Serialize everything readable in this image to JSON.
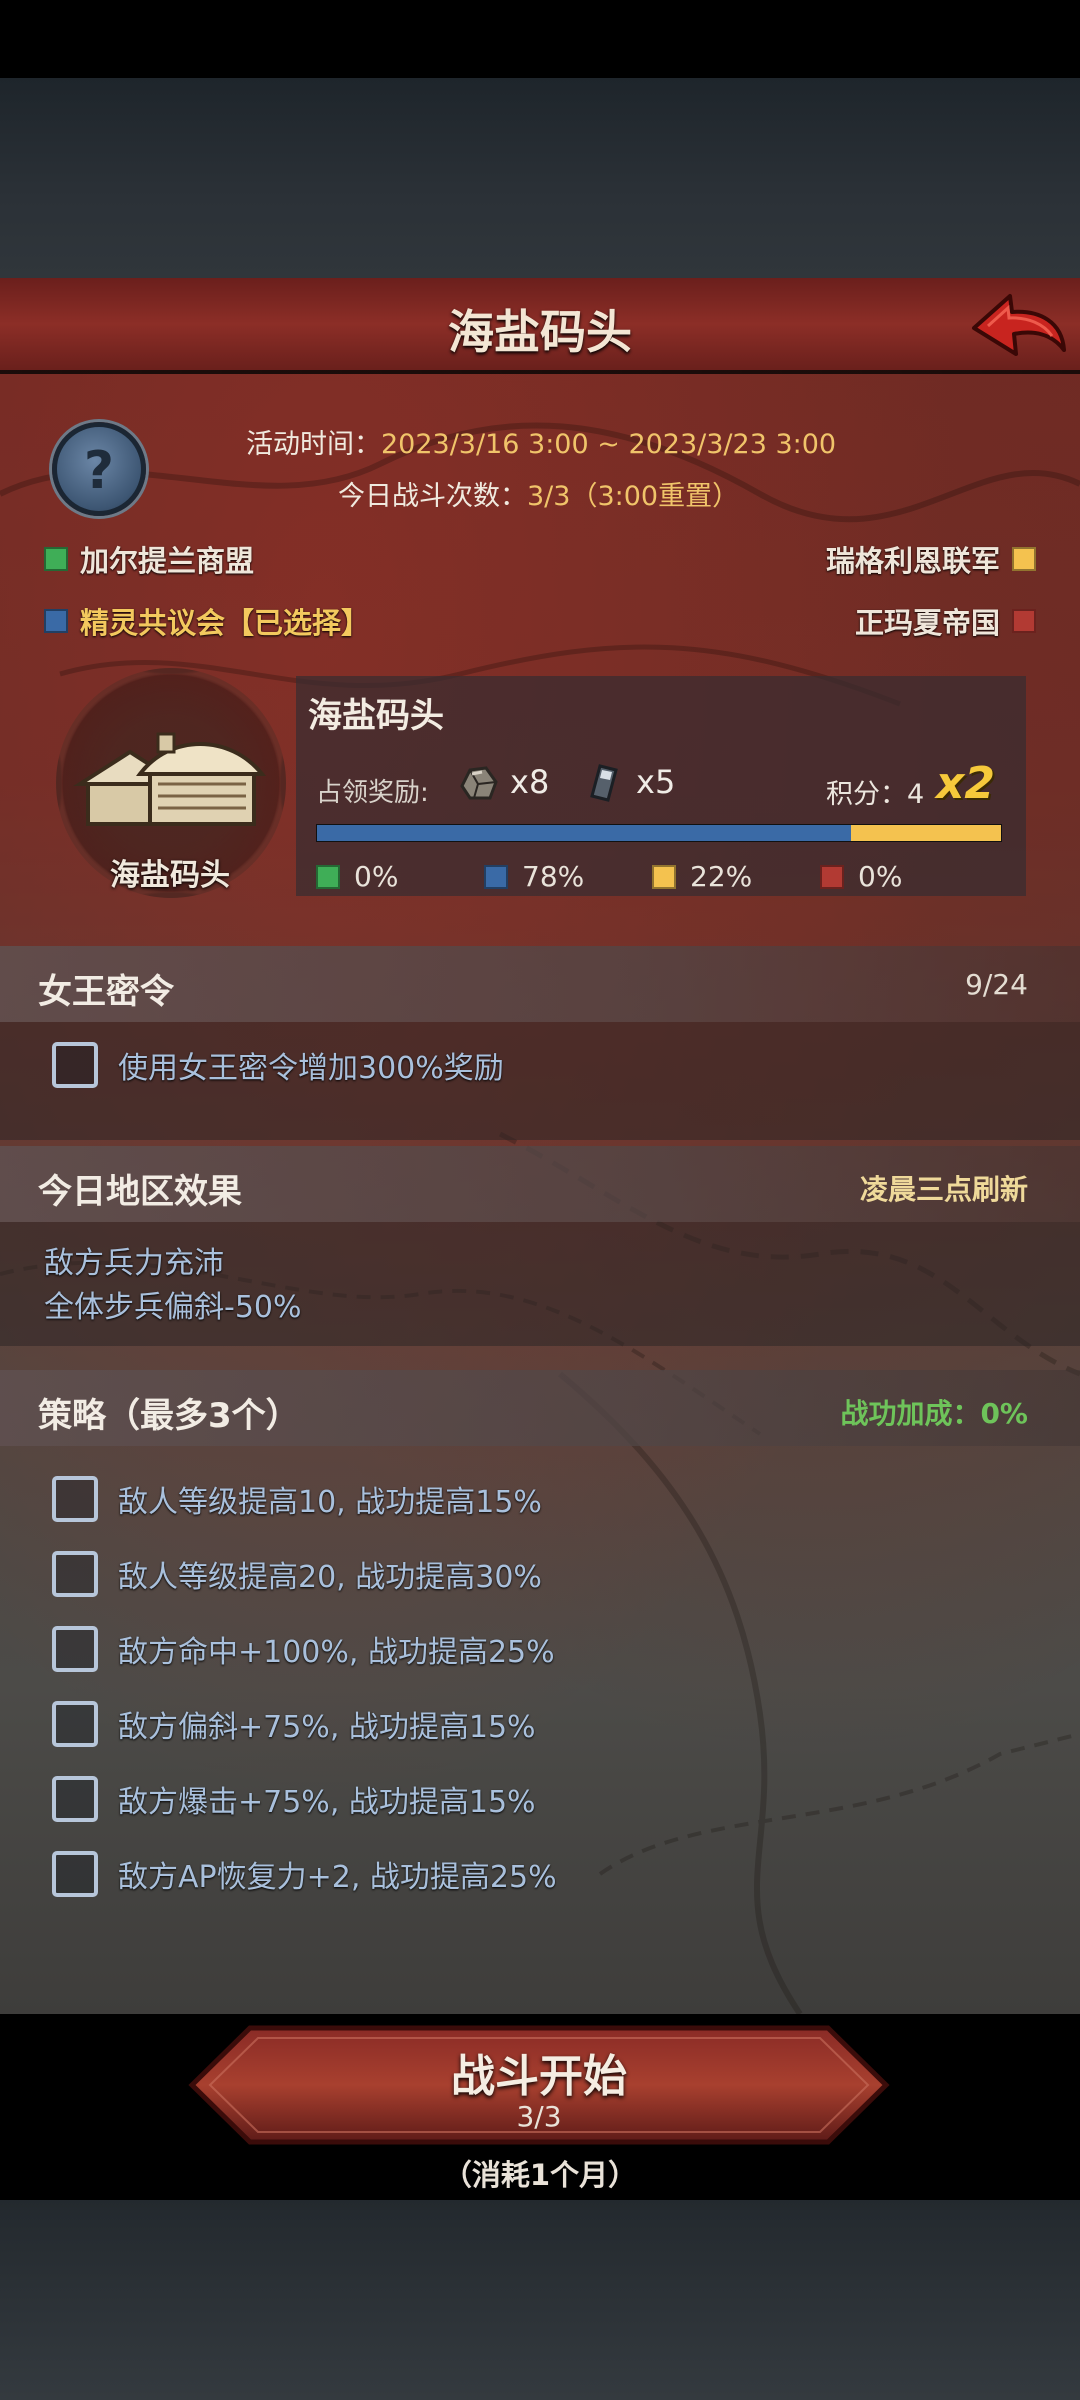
{
  "header": {
    "title": "海盐码头"
  },
  "event": {
    "time_label": "活动时间：",
    "time_value": "2023/3/16 3:00 ~ 2023/3/23 3:00",
    "battles_label": "今日战斗次数：",
    "battles_value": "3/3（3:00重置）"
  },
  "factions": [
    {
      "name": "加尔提兰商盟",
      "color": "#3fae57"
    },
    {
      "name": "瑞格利恩联军",
      "color": "#f4c24f"
    },
    {
      "name": "精灵共议会【已选择】",
      "color": "#3a6aa6"
    },
    {
      "name": "正玛夏帝国",
      "color": "#b23a33"
    }
  ],
  "node": {
    "label": "海盐码头",
    "card_title": "海盐码头",
    "reward_label": "占领奖励:",
    "rewards": [
      {
        "icon": "stone-ore-icon",
        "amount": "x8"
      },
      {
        "icon": "iron-ingot-icon",
        "amount": "x5"
      }
    ],
    "score_label": "积分：4",
    "multiplier": "x2",
    "shares": [
      {
        "pct": "0%",
        "value": 0,
        "color": "#3fae57"
      },
      {
        "pct": "78%",
        "value": 78,
        "color": "#3a6aa6"
      },
      {
        "pct": "22%",
        "value": 22,
        "color": "#f4c24f"
      },
      {
        "pct": "0%",
        "value": 0,
        "color": "#b23a33"
      }
    ]
  },
  "queen_order": {
    "title": "女王密令",
    "count": "9/24",
    "option": "使用女王密令增加300%奖励"
  },
  "region": {
    "title": "今日地区效果",
    "refresh": "凌晨三点刷新",
    "effects": [
      "敌方兵力充沛",
      "全体步兵偏斜-50%"
    ]
  },
  "strategy": {
    "title": "策略（最多3个）",
    "bonus": "战功加成：0%",
    "options": [
      "敌人等级提高10, 战功提高15%",
      "敌人等级提高20, 战功提高30%",
      "敌方命中+100%, 战功提高25%",
      "敌方偏斜+75%, 战功提高15%",
      "敌方爆击+75%, 战功提高15%",
      "敌方AP恢复力+2, 战功提高25%"
    ]
  },
  "start": {
    "label": "战斗开始",
    "count": "3/3",
    "cost": "（消耗1个月）"
  }
}
